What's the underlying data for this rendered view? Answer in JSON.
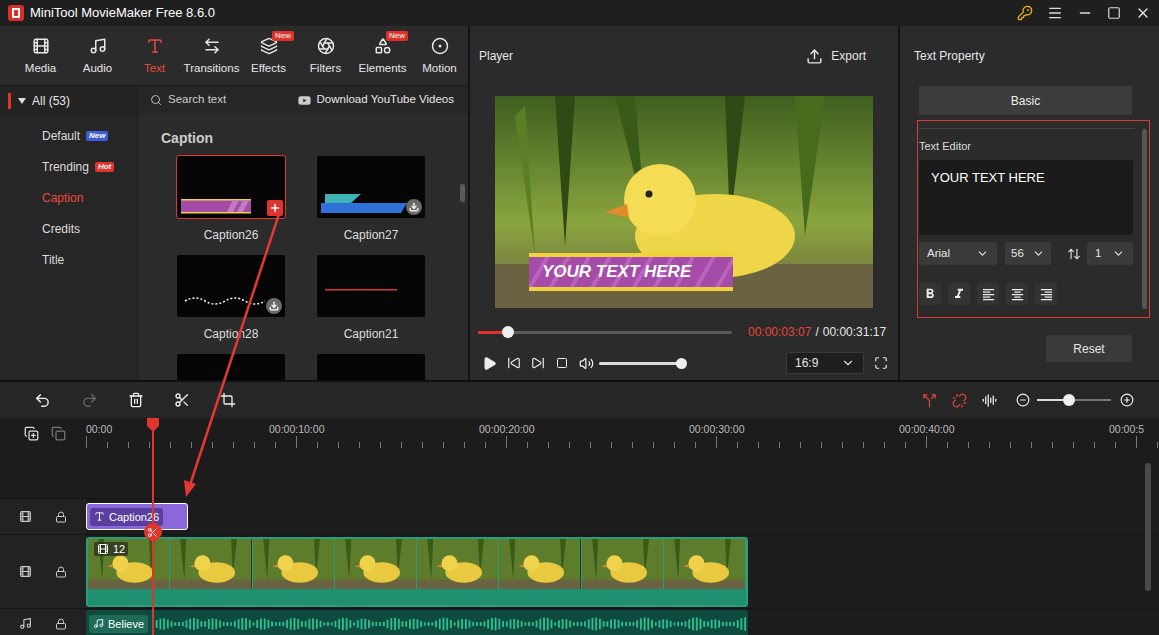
{
  "window": {
    "title": "MiniTool MovieMaker Free 8.6.0"
  },
  "toolbar": [
    {
      "label": "Media",
      "selected": false,
      "badge": ""
    },
    {
      "label": "Audio",
      "selected": false,
      "badge": ""
    },
    {
      "label": "Text",
      "selected": true,
      "badge": ""
    },
    {
      "label": "Transitions",
      "selected": false,
      "badge": ""
    },
    {
      "label": "Effects",
      "selected": false,
      "badge": "New"
    },
    {
      "label": "Filters",
      "selected": false,
      "badge": ""
    },
    {
      "label": "Elements",
      "selected": false,
      "badge": "New"
    },
    {
      "label": "Motion",
      "selected": false,
      "badge": ""
    }
  ],
  "categories": {
    "label": "All (53)",
    "expanded": true,
    "items": [
      {
        "label": "Default",
        "selected": false,
        "badge": "New",
        "color": "#3b5fd9"
      },
      {
        "label": "Trending",
        "selected": false,
        "badge": "Hot",
        "color": "#e5322d"
      },
      {
        "label": "Caption",
        "selected": true,
        "badge": "",
        "color": ""
      },
      {
        "label": "Credits",
        "selected": false,
        "badge": "",
        "color": ""
      },
      {
        "label": "Title",
        "selected": false,
        "badge": "",
        "color": ""
      }
    ]
  },
  "search": {
    "placeholder": "Search text"
  },
  "download": "Download YouTube Videos",
  "section": "Caption",
  "templates": [
    {
      "name": "Caption26",
      "kind": "banner",
      "selected": true,
      "action": "add"
    },
    {
      "name": "Caption27",
      "kind": "ribbon",
      "selected": false,
      "action": "download"
    },
    {
      "name": "Caption28",
      "kind": "script",
      "selected": false,
      "action": "download"
    },
    {
      "name": "Caption21",
      "kind": "line",
      "selected": false,
      "action": "none"
    },
    {
      "name": "",
      "kind": "blank",
      "selected": false,
      "action": "none"
    },
    {
      "name": "",
      "kind": "blank",
      "selected": false,
      "action": "none"
    }
  ],
  "player": {
    "title": "Player",
    "export": "Export",
    "current": "00:00:03:07",
    "separator": "/",
    "total": "00:00:31:17",
    "progress": 0.12,
    "volume": 1,
    "aspect": "16:9"
  },
  "text_property": {
    "title": "Text Property",
    "tabs": [
      {
        "label": "Basic",
        "selected": true
      }
    ],
    "editor_label": "Text Editor",
    "value": "YOUR TEXT HERE",
    "font": "Arial",
    "size": "56",
    "line_spacing": "1",
    "reset": "Reset"
  },
  "timeline": {
    "ticks": [
      "00:00",
      "00:00:10:00",
      "00:00:20:00",
      "00:00:30:00",
      "00:00:40:00",
      "00:00:5"
    ],
    "zoom": 0.43,
    "playhead": 0.062,
    "redo_disabled": true,
    "tracks": [
      {
        "kind": "empty",
        "label": "",
        "length": 0,
        "selected": false
      },
      {
        "kind": "text",
        "label": "Caption26",
        "length": 0.095,
        "selected": true
      },
      {
        "kind": "video",
        "label": "12",
        "length": 0.617,
        "selected": false
      },
      {
        "kind": "audio",
        "label": "Believe",
        "length": 0.617,
        "selected": false
      }
    ]
  }
}
